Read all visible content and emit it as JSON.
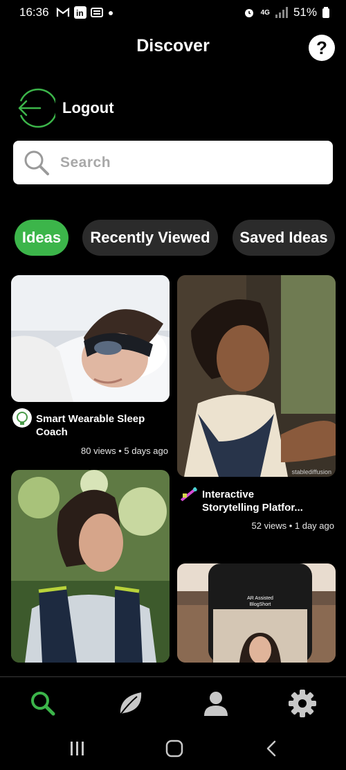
{
  "status_bar": {
    "time": "16:36",
    "network": "4G",
    "battery": "51%"
  },
  "header": {
    "title": "Discover",
    "help_label": "?"
  },
  "logout": {
    "label": "Logout"
  },
  "search": {
    "placeholder": "Search"
  },
  "tabs": [
    {
      "label": "Ideas",
      "active": true
    },
    {
      "label": "Recently Viewed",
      "active": false
    },
    {
      "label": "Saved Ideas",
      "active": false
    }
  ],
  "cards": [
    {
      "title_line1": "Smart Wearable Sleep",
      "title_line2": "Coach",
      "info": "80 views • 5 days ago"
    },
    {
      "title_line1": "Interactive",
      "title_line2": "Storytelling Platfor...",
      "info": "52 views • 1 day ago",
      "watermark": "stablediffusion"
    },
    {
      "title_line1": "",
      "title_line2": "",
      "info": ""
    },
    {
      "phone_screen_title": "AR Assisted",
      "phone_screen_sub": "BlogShort"
    }
  ],
  "colors": {
    "accent": "#3cb54a",
    "chip_bg": "#2b2b2b"
  },
  "bottom_nav": [
    "search-icon",
    "leaf-icon",
    "person-icon",
    "gear-icon"
  ],
  "system_nav": [
    "recents-icon",
    "home-icon",
    "back-icon"
  ]
}
